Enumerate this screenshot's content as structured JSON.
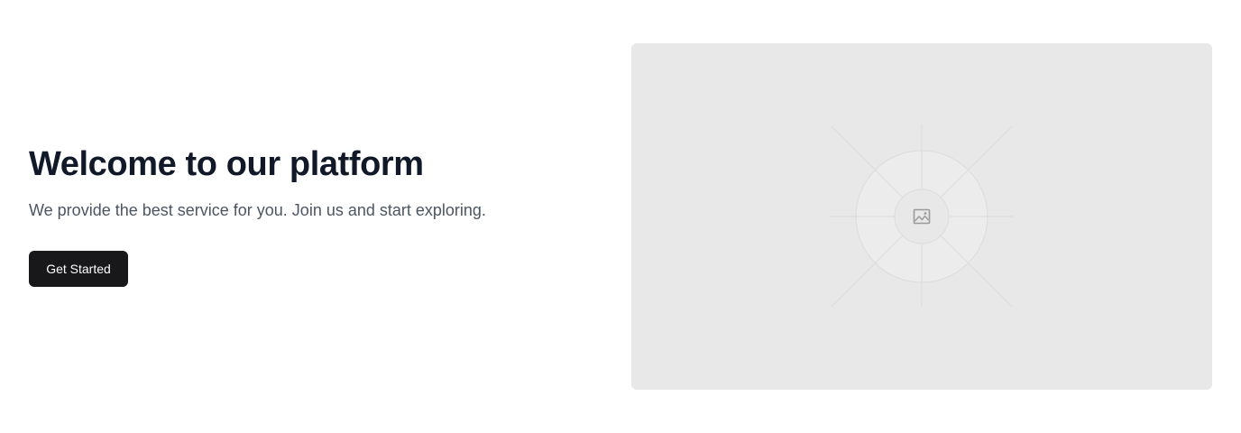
{
  "hero": {
    "title": "Welcome to our platform",
    "subtitle": "We provide the best service for you. Join us and start exploring.",
    "cta_label": "Get Started"
  },
  "media": {
    "icon": "image-icon",
    "background_color": "#e8e8e8"
  },
  "colors": {
    "title": "#111827",
    "subtitle": "#4b5563",
    "button_bg": "#18181b",
    "button_text": "#ffffff"
  }
}
